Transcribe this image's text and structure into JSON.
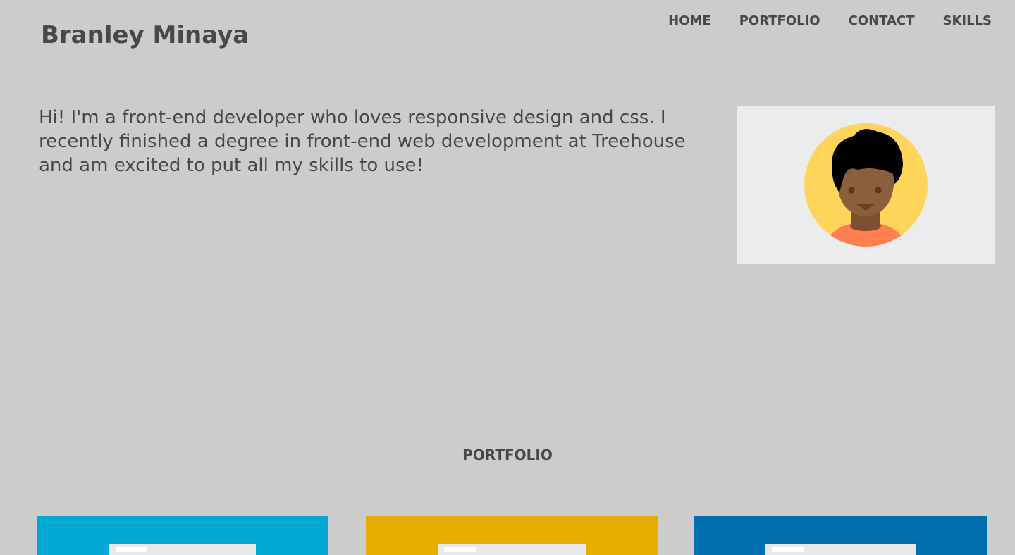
{
  "header": {
    "title": "Branley Minaya",
    "nav": [
      {
        "label": "HOME"
      },
      {
        "label": "PORTFOLIO"
      },
      {
        "label": "CONTACT"
      },
      {
        "label": "SKILLS"
      }
    ]
  },
  "intro": {
    "text": "Hi! I'm a front-end developer who loves responsive design and css. I recently finished a degree in front-end web development at Treehouse and am excited to put all my skills to use!"
  },
  "avatar": {
    "icon": "person-avatar-icon",
    "circle_color": "#FFD45A",
    "skin_color": "#8B5E3C",
    "hair_color": "#000000",
    "shirt_color": "#FF7F50"
  },
  "portfolio": {
    "heading": "PORTFOLIO",
    "tiles": [
      {
        "icon": "browser-window-icon",
        "color": "#00AAD4"
      },
      {
        "icon": "browser-window-icon",
        "color": "#E6AF00"
      },
      {
        "icon": "browser-window-icon",
        "color": "#006EAF"
      }
    ]
  }
}
